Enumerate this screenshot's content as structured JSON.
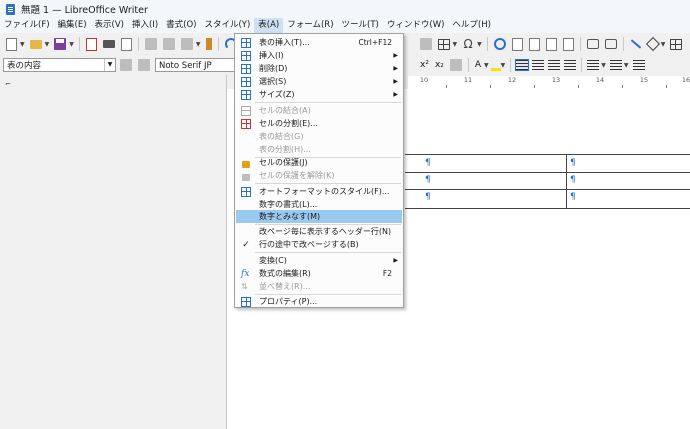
{
  "window": {
    "title": "無題 1 — LibreOffice Writer"
  },
  "menubar": [
    "ファイル(F)",
    "編集(E)",
    "表示(V)",
    "挿入(I)",
    "書式(O)",
    "スタイル(Y)",
    "表(A)",
    "フォーム(R)",
    "ツール(T)",
    "ウィンドウ(W)",
    "ヘルプ(H)"
  ],
  "formatting": {
    "paragraph_style": "表の内容",
    "font_name": "Noto Serif JP",
    "superscript": "x²",
    "subscript": "x₂",
    "font_color": "A"
  },
  "ruler_ticks": [
    "10",
    "11",
    "12",
    "13",
    "14",
    "15",
    "16"
  ],
  "pilcrow": "¶",
  "table_menu": {
    "items": [
      {
        "label": "表の挿入(T)...",
        "shortcut": "Ctrl+F12",
        "icon": "insert-table-icon"
      },
      {
        "label": "挿入(I)",
        "submenu": true,
        "icon": "insert-rows-icon"
      },
      {
        "label": "削除(D)",
        "submenu": true,
        "icon": "delete-rows-icon"
      },
      {
        "label": "選択(S)",
        "submenu": true,
        "icon": "select-table-icon"
      },
      {
        "label": "サイズ(Z)",
        "submenu": true,
        "icon": "size-icon"
      },
      {
        "label": "セルの結合(A)",
        "disabled": true,
        "icon": "merge-cells-icon"
      },
      {
        "label": "セルの分割(E)...",
        "icon": "split-cells-icon"
      },
      {
        "label": "表の結合(G)",
        "disabled": true
      },
      {
        "label": "表の分割(H)...",
        "disabled": true
      },
      {
        "label": "セルの保護(J)",
        "icon": "protect-cells-icon"
      },
      {
        "label": "セルの保護を解除(K)",
        "disabled": true,
        "icon": "unprotect-cells-icon"
      },
      {
        "label": "オートフォーマットのスタイル(F)...",
        "icon": "autoformat-icon"
      },
      {
        "label": "数字の書式(L)..."
      },
      {
        "label": "数字とみなす(M)",
        "highlighted": true
      },
      {
        "label": "改ページ毎に表示するヘッダー行(N)"
      },
      {
        "label": "行の途中で改ページする(B)",
        "checked": true,
        "check_mark": "✓"
      },
      {
        "label": "変換(C)",
        "submenu": true
      },
      {
        "label": "数式の編集(R)",
        "shortcut": "F2",
        "icon": "formula-icon",
        "icon_glyph": "fx"
      },
      {
        "label": "並べ替え(R)...",
        "disabled": true,
        "icon": "sort-icon"
      },
      {
        "label": "プロパティ(P)...",
        "icon": "table-properties-icon"
      }
    ]
  }
}
